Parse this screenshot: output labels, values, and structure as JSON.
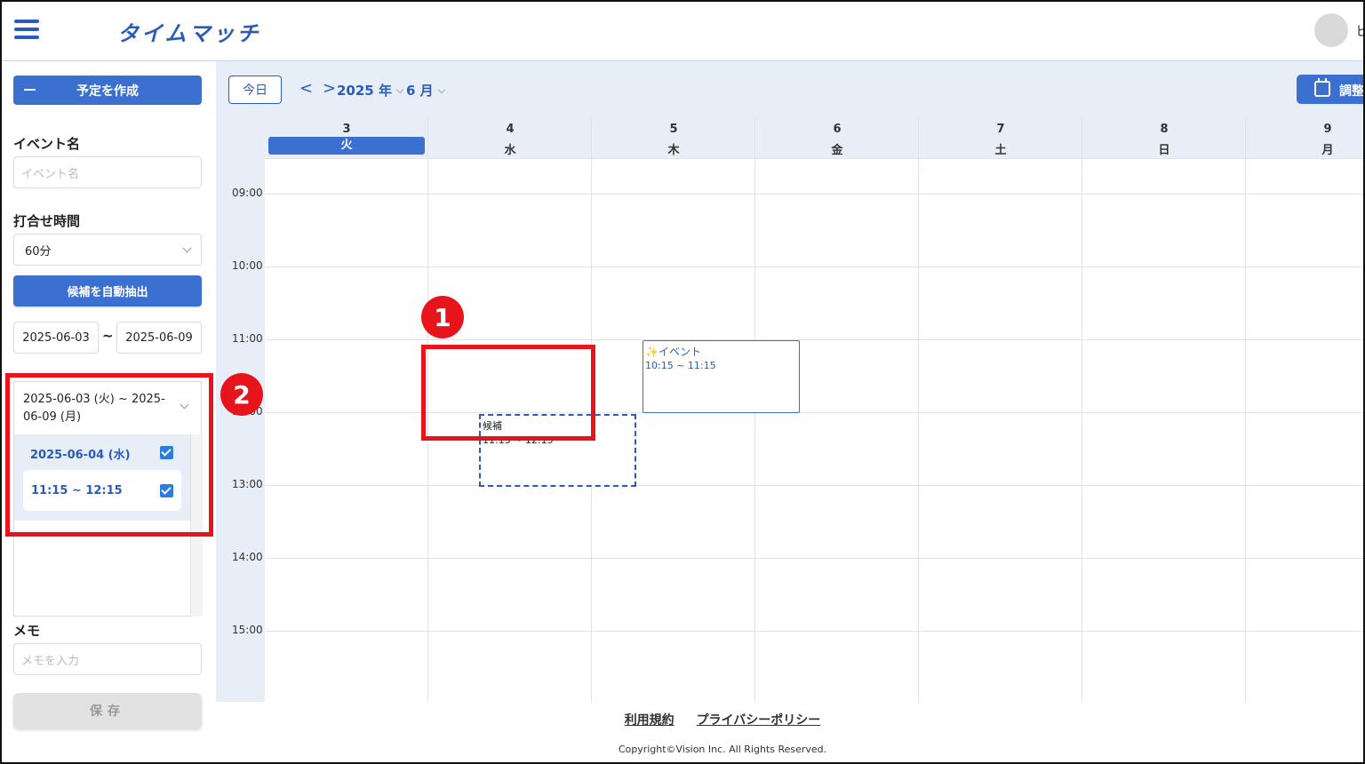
{
  "header": {
    "logo": "タイムマッチ",
    "user_initial": "ヒ"
  },
  "sidebar": {
    "create_button": "予定を作成",
    "event_name_label": "イベント名",
    "event_name_placeholder": "イベント名",
    "duration_label": "打合せ時間",
    "duration_value": "60分",
    "auto_extract_button": "候補を自動抽出",
    "range_start": "2025-06-03",
    "range_separator": "~",
    "range_end": "2025-06-09",
    "candidates": {
      "range_title": "2025-06-03 (火) ~ 2025-06-09 (月)",
      "date_label": "2025-06-04 (水)",
      "date_checked": true,
      "slot_time": "11:15 ~ 12:15",
      "slot_checked": true
    },
    "memo_label": "メモ",
    "memo_placeholder": "メモを入力",
    "save_button": "保存"
  },
  "toolbar": {
    "today": "今日",
    "prev": "<",
    "next": ">",
    "year": "2025 年",
    "month": "6 月",
    "adjust": "調整"
  },
  "calendar": {
    "days": [
      {
        "num": "3",
        "weekday": "火",
        "today": true
      },
      {
        "num": "4",
        "weekday": "水",
        "today": false
      },
      {
        "num": "5",
        "weekday": "木",
        "today": false
      },
      {
        "num": "6",
        "weekday": "金",
        "today": false
      },
      {
        "num": "7",
        "weekday": "土",
        "today": false
      },
      {
        "num": "8",
        "weekday": "日",
        "today": false
      },
      {
        "num": "9",
        "weekday": "月",
        "today": false
      }
    ],
    "times": [
      "09:00",
      "10:00",
      "11:00",
      "12:00",
      "13:00",
      "14:00",
      "15:00"
    ],
    "event": {
      "title": "✨イベント",
      "time": "10:15 ~ 11:15"
    },
    "candidate": {
      "title": "候補",
      "time": "11:15 ~ 12:15"
    }
  },
  "annotations": {
    "badge1": "1",
    "badge2": "2"
  },
  "footer": {
    "terms": "利用規約",
    "privacy": "プライバシーポリシー",
    "copyright": "Copyright©Vision Inc. All Rights Reserved."
  },
  "colors": {
    "accent": "#3b6fd0",
    "annotation": "#e8141c",
    "calendar_bg": "#e8eef8"
  }
}
